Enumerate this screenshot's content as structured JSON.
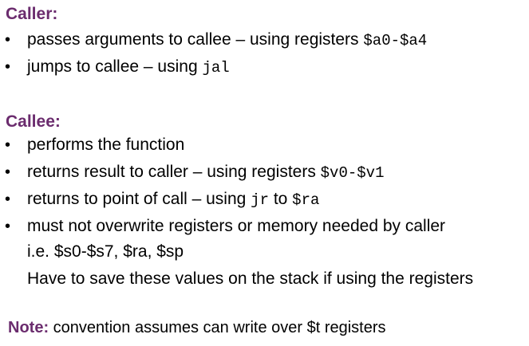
{
  "colors": {
    "heading": "#6b2c6e",
    "text": "#000000",
    "background": "#ffffff"
  },
  "caller": {
    "heading": "Caller:",
    "bullet_glyph": "•",
    "items": [
      {
        "text": "passes arguments to callee – using registers ",
        "code": "$a0-$a4"
      },
      {
        "text": "jumps to callee – using ",
        "code": "jal"
      }
    ]
  },
  "callee": {
    "heading": "Callee:",
    "bullet_glyph": "•",
    "items": [
      {
        "text": "performs the function"
      },
      {
        "text": "returns result to caller – using registers ",
        "code": "$v0-$v1"
      },
      {
        "text": "returns to point of call – using ",
        "code": "jr",
        "text2": " to ",
        "code2": "$ra"
      },
      {
        "text": "must not overwrite registers or memory needed by caller"
      }
    ],
    "continuation": [
      "i.e.  $s0-$s7, $ra, $sp",
      "Have to save these values on the stack if using the registers"
    ]
  },
  "note": {
    "label": "Note:",
    "text": " convention assumes can write over $t registers"
  }
}
